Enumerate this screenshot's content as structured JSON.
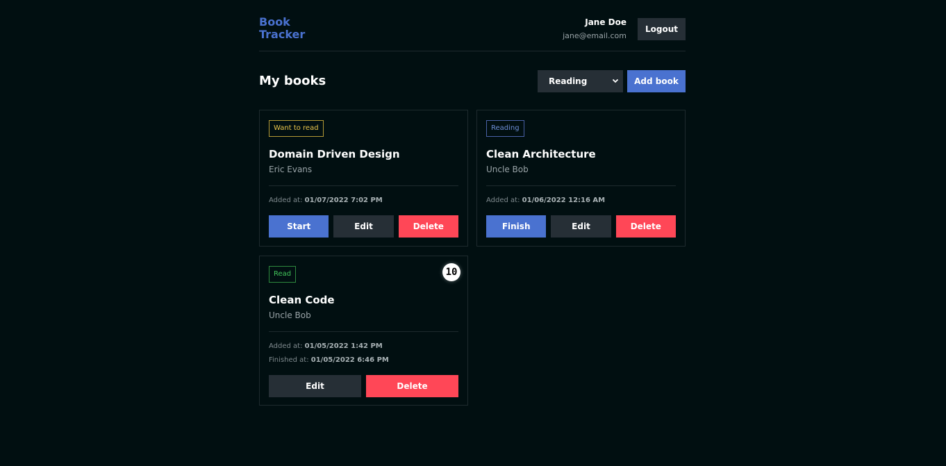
{
  "app": {
    "logo_line1": "Book",
    "logo_line2": "Tracker"
  },
  "user": {
    "name": "Jane Doe",
    "email": "jane@email.com",
    "logout_label": "Logout"
  },
  "main": {
    "title": "My books",
    "filter_selected": "Reading",
    "add_book_label": "Add book"
  },
  "books": [
    {
      "status": "Want to read",
      "title": "Domain Driven Design",
      "author": "Eric Evans",
      "added_label": "Added at:",
      "added_at": "01/07/2022 7:02 PM",
      "actions": [
        "Start",
        "Edit",
        "Delete"
      ]
    },
    {
      "status": "Reading",
      "title": "Clean Architecture",
      "author": "Uncle Bob",
      "added_label": "Added at:",
      "added_at": "01/06/2022 12:16 AM",
      "actions": [
        "Finish",
        "Edit",
        "Delete"
      ]
    },
    {
      "status": "Read",
      "title": "Clean Code",
      "author": "Uncle Bob",
      "added_label": "Added at:",
      "added_at": "01/05/2022 1:42 PM",
      "finished_label": "Finished at:",
      "finished_at": "01/05/2022 6:46 PM",
      "rating": "10",
      "actions": [
        "Edit",
        "Delete"
      ]
    }
  ],
  "colors": {
    "background": "#010f11",
    "accent": "#4a72d0",
    "danger": "#ff4757",
    "secondary": "#262f36",
    "want_to_read": "#e8c44b",
    "reading": "#6e8fd8",
    "read": "#41c35a"
  },
  "icons": {
    "select_chevron": "chevron-down-icon"
  }
}
